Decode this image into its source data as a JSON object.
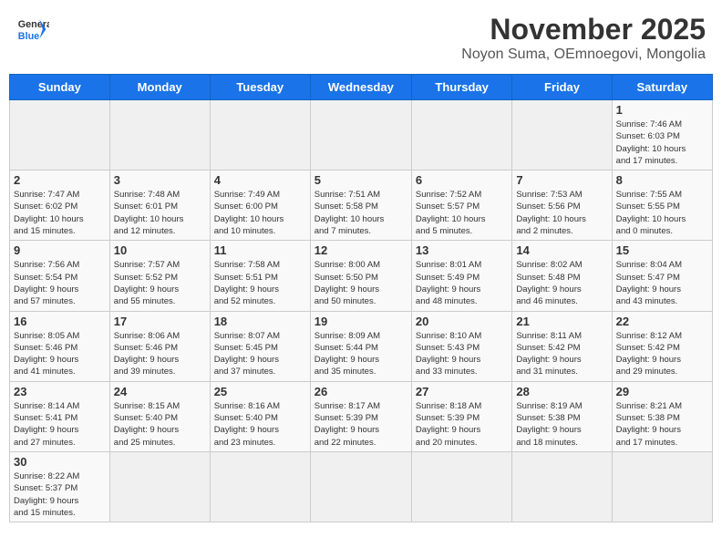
{
  "header": {
    "logo_text_general": "General",
    "logo_text_blue": "Blue",
    "month_title": "November 2025",
    "subtitle": "Noyon Suma, OEmnoegovi, Mongolia"
  },
  "days_of_week": [
    "Sunday",
    "Monday",
    "Tuesday",
    "Wednesday",
    "Thursday",
    "Friday",
    "Saturday"
  ],
  "weeks": [
    [
      {
        "day": "",
        "info": ""
      },
      {
        "day": "",
        "info": ""
      },
      {
        "day": "",
        "info": ""
      },
      {
        "day": "",
        "info": ""
      },
      {
        "day": "",
        "info": ""
      },
      {
        "day": "",
        "info": ""
      },
      {
        "day": "1",
        "info": "Sunrise: 7:46 AM\nSunset: 6:03 PM\nDaylight: 10 hours\nand 17 minutes."
      }
    ],
    [
      {
        "day": "2",
        "info": "Sunrise: 7:47 AM\nSunset: 6:02 PM\nDaylight: 10 hours\nand 15 minutes."
      },
      {
        "day": "3",
        "info": "Sunrise: 7:48 AM\nSunset: 6:01 PM\nDaylight: 10 hours\nand 12 minutes."
      },
      {
        "day": "4",
        "info": "Sunrise: 7:49 AM\nSunset: 6:00 PM\nDaylight: 10 hours\nand 10 minutes."
      },
      {
        "day": "5",
        "info": "Sunrise: 7:51 AM\nSunset: 5:58 PM\nDaylight: 10 hours\nand 7 minutes."
      },
      {
        "day": "6",
        "info": "Sunrise: 7:52 AM\nSunset: 5:57 PM\nDaylight: 10 hours\nand 5 minutes."
      },
      {
        "day": "7",
        "info": "Sunrise: 7:53 AM\nSunset: 5:56 PM\nDaylight: 10 hours\nand 2 minutes."
      },
      {
        "day": "8",
        "info": "Sunrise: 7:55 AM\nSunset: 5:55 PM\nDaylight: 10 hours\nand 0 minutes."
      }
    ],
    [
      {
        "day": "9",
        "info": "Sunrise: 7:56 AM\nSunset: 5:54 PM\nDaylight: 9 hours\nand 57 minutes."
      },
      {
        "day": "10",
        "info": "Sunrise: 7:57 AM\nSunset: 5:52 PM\nDaylight: 9 hours\nand 55 minutes."
      },
      {
        "day": "11",
        "info": "Sunrise: 7:58 AM\nSunset: 5:51 PM\nDaylight: 9 hours\nand 52 minutes."
      },
      {
        "day": "12",
        "info": "Sunrise: 8:00 AM\nSunset: 5:50 PM\nDaylight: 9 hours\nand 50 minutes."
      },
      {
        "day": "13",
        "info": "Sunrise: 8:01 AM\nSunset: 5:49 PM\nDaylight: 9 hours\nand 48 minutes."
      },
      {
        "day": "14",
        "info": "Sunrise: 8:02 AM\nSunset: 5:48 PM\nDaylight: 9 hours\nand 46 minutes."
      },
      {
        "day": "15",
        "info": "Sunrise: 8:04 AM\nSunset: 5:47 PM\nDaylight: 9 hours\nand 43 minutes."
      }
    ],
    [
      {
        "day": "16",
        "info": "Sunrise: 8:05 AM\nSunset: 5:46 PM\nDaylight: 9 hours\nand 41 minutes."
      },
      {
        "day": "17",
        "info": "Sunrise: 8:06 AM\nSunset: 5:46 PM\nDaylight: 9 hours\nand 39 minutes."
      },
      {
        "day": "18",
        "info": "Sunrise: 8:07 AM\nSunset: 5:45 PM\nDaylight: 9 hours\nand 37 minutes."
      },
      {
        "day": "19",
        "info": "Sunrise: 8:09 AM\nSunset: 5:44 PM\nDaylight: 9 hours\nand 35 minutes."
      },
      {
        "day": "20",
        "info": "Sunrise: 8:10 AM\nSunset: 5:43 PM\nDaylight: 9 hours\nand 33 minutes."
      },
      {
        "day": "21",
        "info": "Sunrise: 8:11 AM\nSunset: 5:42 PM\nDaylight: 9 hours\nand 31 minutes."
      },
      {
        "day": "22",
        "info": "Sunrise: 8:12 AM\nSunset: 5:42 PM\nDaylight: 9 hours\nand 29 minutes."
      }
    ],
    [
      {
        "day": "23",
        "info": "Sunrise: 8:14 AM\nSunset: 5:41 PM\nDaylight: 9 hours\nand 27 minutes."
      },
      {
        "day": "24",
        "info": "Sunrise: 8:15 AM\nSunset: 5:40 PM\nDaylight: 9 hours\nand 25 minutes."
      },
      {
        "day": "25",
        "info": "Sunrise: 8:16 AM\nSunset: 5:40 PM\nDaylight: 9 hours\nand 23 minutes."
      },
      {
        "day": "26",
        "info": "Sunrise: 8:17 AM\nSunset: 5:39 PM\nDaylight: 9 hours\nand 22 minutes."
      },
      {
        "day": "27",
        "info": "Sunrise: 8:18 AM\nSunset: 5:39 PM\nDaylight: 9 hours\nand 20 minutes."
      },
      {
        "day": "28",
        "info": "Sunrise: 8:19 AM\nSunset: 5:38 PM\nDaylight: 9 hours\nand 18 minutes."
      },
      {
        "day": "29",
        "info": "Sunrise: 8:21 AM\nSunset: 5:38 PM\nDaylight: 9 hours\nand 17 minutes."
      }
    ],
    [
      {
        "day": "30",
        "info": "Sunrise: 8:22 AM\nSunset: 5:37 PM\nDaylight: 9 hours\nand 15 minutes."
      },
      {
        "day": "",
        "info": ""
      },
      {
        "day": "",
        "info": ""
      },
      {
        "day": "",
        "info": ""
      },
      {
        "day": "",
        "info": ""
      },
      {
        "day": "",
        "info": ""
      },
      {
        "day": "",
        "info": ""
      }
    ]
  ]
}
